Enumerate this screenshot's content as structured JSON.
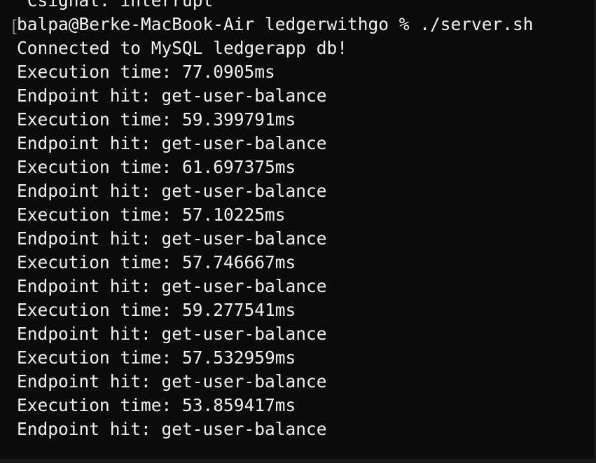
{
  "terminal": {
    "bracket_glyph": "[",
    "lines": [
      "^Csignal: interrupt",
      "balpa@Berke-MacBook-Air ledgerwithgo % ./server.sh",
      "Connected to MySQL ledgerapp db!",
      "Execution time: 77.0905ms",
      "Endpoint hit: get-user-balance",
      "Execution time: 59.399791ms",
      "Endpoint hit: get-user-balance",
      "Execution time: 61.697375ms",
      "Endpoint hit: get-user-balance",
      "Execution time: 57.10225ms",
      "Endpoint hit: get-user-balance",
      "Execution time: 57.746667ms",
      "Endpoint hit: get-user-balance",
      "Execution time: 59.277541ms",
      "Endpoint hit: get-user-balance",
      "Execution time: 57.532959ms",
      "Endpoint hit: get-user-balance",
      "Execution time: 53.859417ms",
      "Endpoint hit: get-user-balance"
    ]
  },
  "colors": {
    "background": "#0b0b0b",
    "text": "#f2f2f2"
  }
}
